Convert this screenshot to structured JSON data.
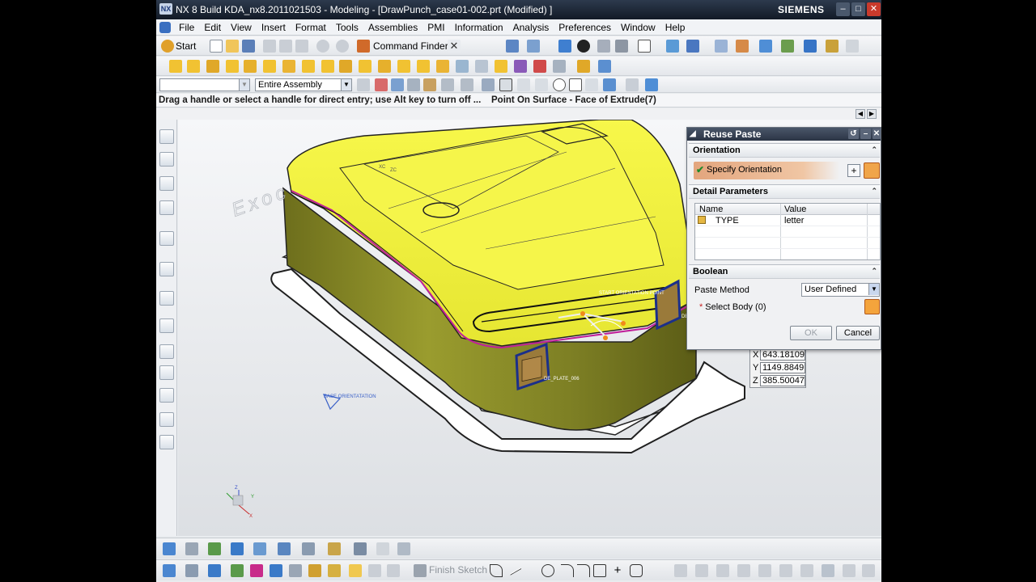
{
  "window": {
    "title": "NX 8  Build KDA_nx8.2011021503 - Modeling - [DrawPunch_case01-002.prt (Modified) ]",
    "brand": "SIEMENS",
    "logo_text": "NX"
  },
  "menu": [
    "File",
    "Edit",
    "View",
    "Insert",
    "Format",
    "Tools",
    "Assemblies",
    "PMI",
    "Information",
    "Analysis",
    "Preferences",
    "Window",
    "Help"
  ],
  "toolbar": {
    "start_label": "Start",
    "command_finder_label": "Command Finder"
  },
  "selection_bar": {
    "filter_value": "",
    "scope_value": "Entire Assembly"
  },
  "cue_line": {
    "prompt": "Drag a handle or select a handle for direct entry; use Alt key to turn off ...",
    "status": "Point On Surface - Face of Extrude(7)"
  },
  "viewport": {
    "watermark": "Exoc",
    "csys_small_labels": [
      "XC",
      "ZC"
    ],
    "start_orientation_label": "START ORIENTATION POINT",
    "base_orientation_label": "BASE ORIENTATATION",
    "plate_label_front": "DE_PLATE_006",
    "plate_label_side": "DE_PLA",
    "triad_labels": [
      "Z",
      "Y",
      "X"
    ]
  },
  "coordinate_input": {
    "x": "643.18109",
    "y": "1149.8849",
    "z": "385.50047"
  },
  "dialog": {
    "title": "Reuse Paste",
    "groups": {
      "orientation": "Orientation",
      "detail_parameters": "Detail Parameters",
      "boolean": "Boolean"
    },
    "specify_orientation": "Specify Orientation",
    "table": {
      "columns": [
        "Name",
        "Value"
      ],
      "rows": [
        {
          "name": "TYPE",
          "value": "letter"
        }
      ]
    },
    "paste_method_label": "Paste Method",
    "paste_method_value": "User Defined",
    "select_body_label": "Select Body (0)",
    "ok_label": "OK",
    "cancel_label": "Cancel"
  },
  "bottom_toolbar": {
    "finish_sketch_label": "Finish Sketch"
  },
  "colors": {
    "title_bar": "#1d2634",
    "accent_orange": "#f0a54a",
    "model_yellow": "#f4f43a",
    "model_olive": "#8c8f2a",
    "magenta_edge": "#c0209a"
  }
}
